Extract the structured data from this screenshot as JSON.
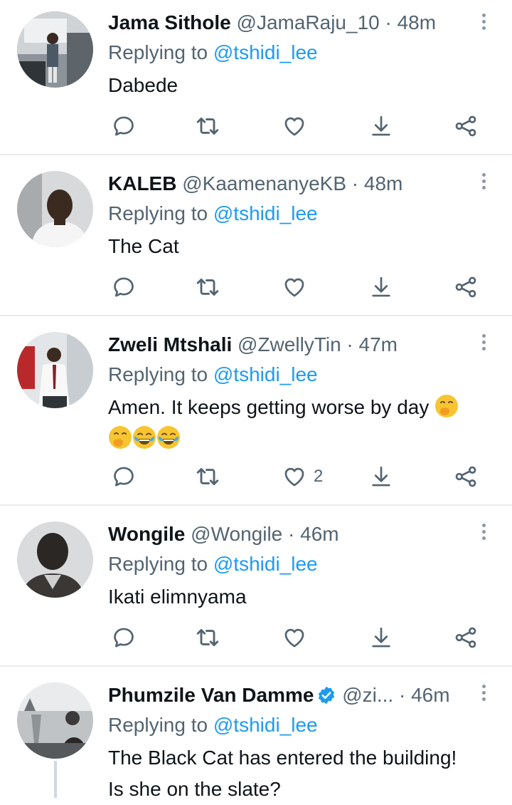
{
  "tweets": [
    {
      "name": "Jama Sithole",
      "handle": "@JamaRaju_10 · 48m",
      "reply_prefix": "Replying to ",
      "reply_to": "@tshidi_lee",
      "text": "Dabede",
      "likes": ""
    },
    {
      "name": "KALEB",
      "handle": "@KaamenanyeKB · 48m",
      "reply_prefix": "Replying to ",
      "reply_to": "@tshidi_lee",
      "text": "The Cat",
      "likes": ""
    },
    {
      "name": "Zweli Mtshali",
      "handle": "@ZwellyTin · 47m",
      "reply_prefix": "Replying to ",
      "reply_to": "@tshidi_lee",
      "text_line1": "Amen. It keeps getting worse by day",
      "likes": "2"
    },
    {
      "name": "Wongile",
      "handle": "@Wongile · 46m",
      "reply_prefix": "Replying to ",
      "reply_to": "@tshidi_lee",
      "text": "Ikati elimnyama",
      "likes": ""
    },
    {
      "name": "Phumzile Van Damme",
      "handle": "@zi... · 46m",
      "reply_prefix": "Replying to ",
      "reply_to": "@tshidi_lee",
      "text_line1": "The Black Cat has entered the building!",
      "text_line2": "Is she on the slate?",
      "likes": ""
    }
  ],
  "icons": {
    "reply": "reply-icon",
    "retweet": "retweet-icon",
    "like": "heart-icon",
    "download": "download-icon",
    "share": "share-icon",
    "more": "more-options-icon",
    "verified": "verified-badge-icon"
  },
  "colors": {
    "accent": "#1d9bf0",
    "secondary_text": "#536471",
    "icon": "#536471",
    "divider": "#e8ebee"
  }
}
